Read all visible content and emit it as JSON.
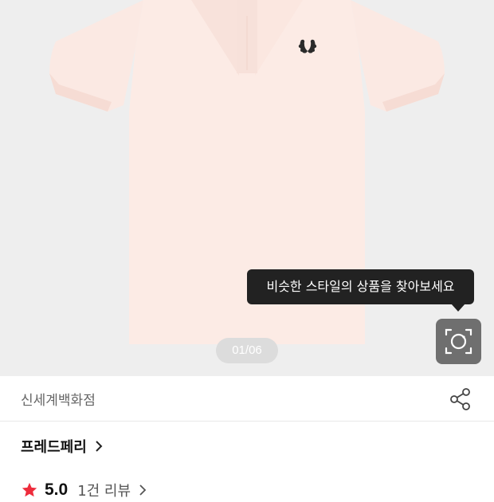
{
  "gallery": {
    "counter": "01/06",
    "tooltip": "비슷한 스타일의 상품을 찾아보세요",
    "lens_icon": "lens-search-icon",
    "colors": {
      "background": "#eeeeee",
      "shirt": "#fbe8e2",
      "logo": "#2b2b2b",
      "tooltip": "#222222",
      "lens_button": "#6f6f6f"
    }
  },
  "store": {
    "name": "신세계백화점",
    "share_icon": "share-icon"
  },
  "brand": {
    "name": "프레드페리",
    "chevron_icon": "chevron-right-icon"
  },
  "rating": {
    "star_icon": "star-icon",
    "score": "5.0",
    "review_count": "1건 리뷰",
    "chevron_icon": "chevron-right-icon",
    "star_color": "#ee2c3c"
  }
}
